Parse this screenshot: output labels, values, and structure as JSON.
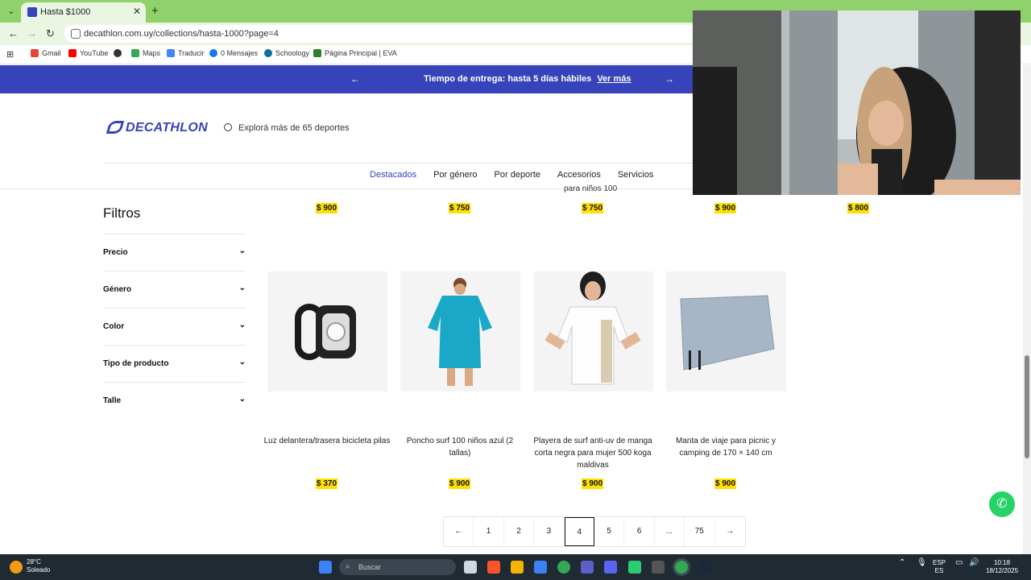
{
  "browser": {
    "tab_title": "Hasta $1000",
    "new_tab": "+",
    "url": "decathlon.com.uy/collections/hasta-1000?page=4",
    "bookmarks": [
      "Gmail",
      "YouTube",
      "Maps",
      "Traducir",
      "0 Mensajes",
      "Schoology",
      "Página Principal | EVA"
    ]
  },
  "promo": {
    "text": "Tiempo de entrega: hasta 5 días hábiles",
    "link": "Ver más"
  },
  "header": {
    "logo": "DECATHLON",
    "search_placeholder": "Explorá más de 65 deportes",
    "nav": [
      "Destacados",
      "Por género",
      "Por deporte",
      "Accesorios",
      "Servicios"
    ]
  },
  "top_row": {
    "cut_title": "para niños 100",
    "prices": [
      "$ 900",
      "$ 750",
      "$ 750",
      "$ 900",
      "$ 800"
    ]
  },
  "filters": {
    "title": "Filtros",
    "items": [
      "Precio",
      "Género",
      "Color",
      "Tipo de producto",
      "Talle"
    ]
  },
  "products": [
    {
      "name": "Luz delantera/trasera bicicleta pilas",
      "price": "$ 370",
      "icon": "bike-light-image"
    },
    {
      "name": "Poncho surf 100 niños azul (2 tallas)",
      "price": "$ 900",
      "icon": "poncho-image"
    },
    {
      "name": "Playera de surf anti-uv de manga corta negra para mujer 500 koga maldivas",
      "price": "$ 900",
      "icon": "surf-shirt-image"
    },
    {
      "name": "Manta de viaje para picnic y camping de 170 × 140 cm",
      "price": "$ 900",
      "icon": "picnic-blanket-image"
    }
  ],
  "pagination": {
    "pages": [
      "1",
      "2",
      "3",
      "4",
      "5",
      "6",
      "...",
      "75"
    ],
    "current": "4"
  },
  "taskbar": {
    "temp": "28°C",
    "weather": "Soleado",
    "search": "Buscar",
    "lang_top": "ESP",
    "lang_bottom": "ES",
    "time": "10:18",
    "date": "18/12/2025"
  },
  "colors": {
    "brand": "#3643ba",
    "price_highlight": "#ffe000",
    "tab_bar": "#8fd16b"
  }
}
